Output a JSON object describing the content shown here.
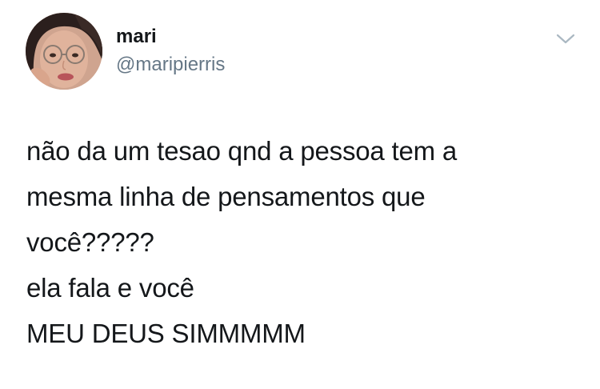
{
  "tweet": {
    "author_name": "mari",
    "author_handle": "@maripierris",
    "menu_icon": "chevron-down-icon",
    "lines": [
      "não da um tesao qnd a pessoa tem a",
      "mesma linha de pensamentos que",
      "você?????",
      "ela fala e você",
      "MEU DEUS SIMMMMM"
    ]
  },
  "colors": {
    "text": "#14171a",
    "handle": "#657786",
    "chevron": "#aab8c2",
    "background": "#ffffff"
  }
}
